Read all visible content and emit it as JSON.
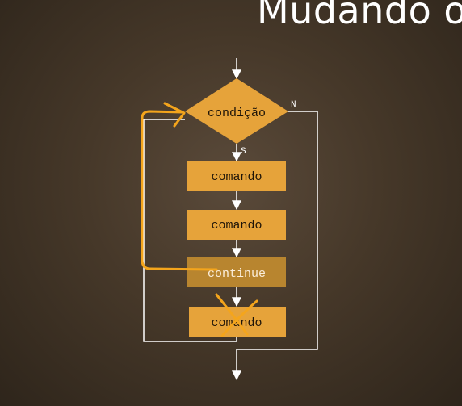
{
  "slide": {
    "title": "Mudando o"
  },
  "flowchart": {
    "condition": "condição",
    "yes_label": "S",
    "no_label": "N",
    "steps": [
      "comando",
      "comando",
      "continue",
      "comando"
    ]
  },
  "colors": {
    "box": "#e6a33a",
    "box_continue": "#b8852f",
    "line": "#ffffff",
    "highlight": "#f4a51c"
  }
}
